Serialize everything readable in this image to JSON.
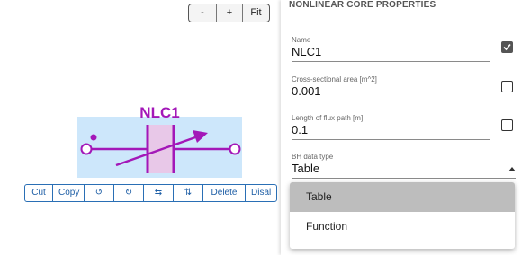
{
  "canvas": {
    "zoom_controls": {
      "zoom_out": "-",
      "zoom_in": "+",
      "fit": "Fit"
    },
    "component_label": "NLC1",
    "toolbar": {
      "cut": "Cut",
      "copy": "Copy",
      "rotate_left": "↺",
      "rotate_right": "↻",
      "flip_horizontal": "⇆",
      "flip_vertical": "⇅",
      "delete": "Delete",
      "disable": "Disal"
    },
    "colors": {
      "component_accent": "#a318b8",
      "selection_fill": "#cde7fb",
      "core_fill": "#e8c8e8",
      "toolbar_blue": "#1f5fa6"
    }
  },
  "panel": {
    "title": "NONLINEAR CORE PROPERTIES",
    "fields": {
      "name": {
        "label": "Name",
        "value": "NLC1",
        "checked": true
      },
      "area": {
        "label": "Cross-sectional area [m^2]",
        "value": "0.001",
        "checked": false
      },
      "length": {
        "label": "Length of flux path [m]",
        "value": "0.1",
        "checked": false
      },
      "bh": {
        "label": "BH data type",
        "value": "Table"
      }
    },
    "dropdown": {
      "options": [
        "Table",
        "Function"
      ],
      "selected": "Table"
    }
  }
}
